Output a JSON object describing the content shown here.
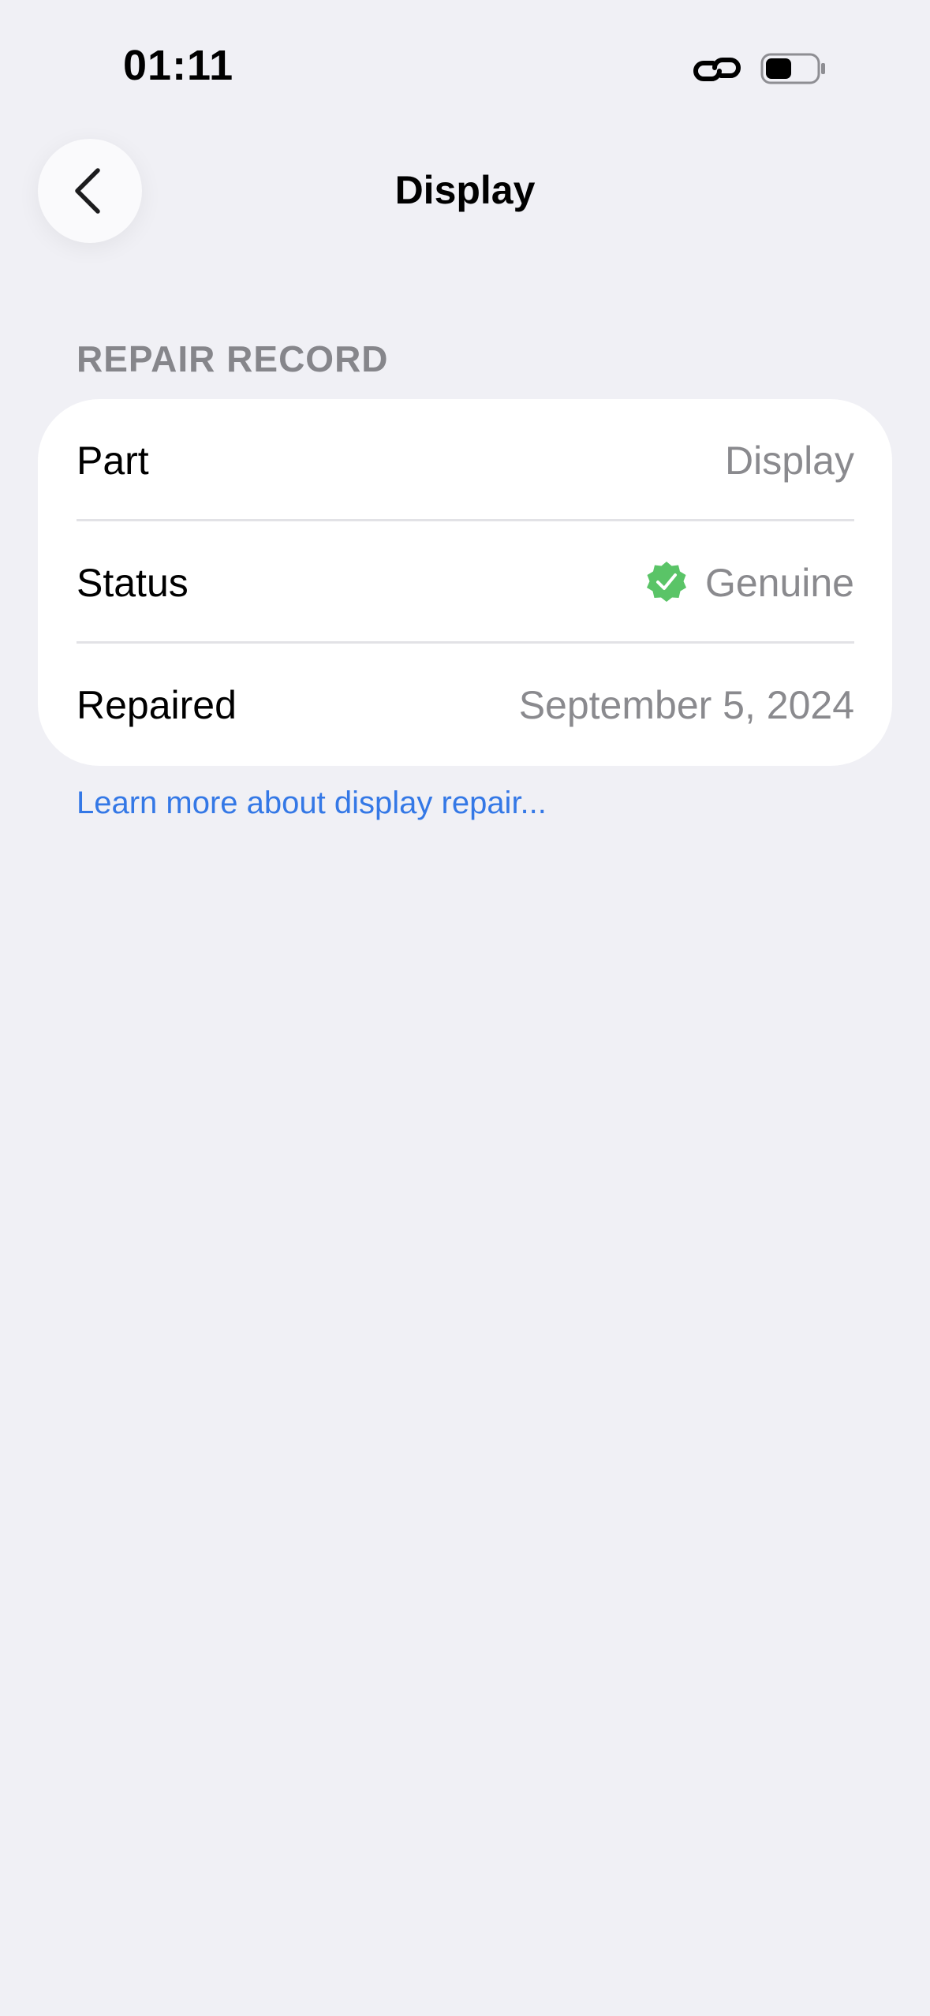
{
  "status_bar": {
    "time": "01:11",
    "icons": [
      "link-icon",
      "battery-icon"
    ]
  },
  "nav": {
    "title": "Display",
    "back_icon": "chevron-left-icon"
  },
  "section": {
    "header": "REPAIR RECORD",
    "rows": [
      {
        "label": "Part",
        "value": "Display"
      },
      {
        "label": "Status",
        "value": "Genuine",
        "icon": "verified-badge-icon",
        "icon_color": "#5ac467"
      },
      {
        "label": "Repaired",
        "value": "September 5, 2024"
      }
    ]
  },
  "footer": {
    "link": "Learn more about display repair..."
  },
  "colors": {
    "background": "#f0f0f5",
    "card": "#ffffff",
    "secondary_text": "#8a8a8e",
    "link": "#3478e6"
  }
}
